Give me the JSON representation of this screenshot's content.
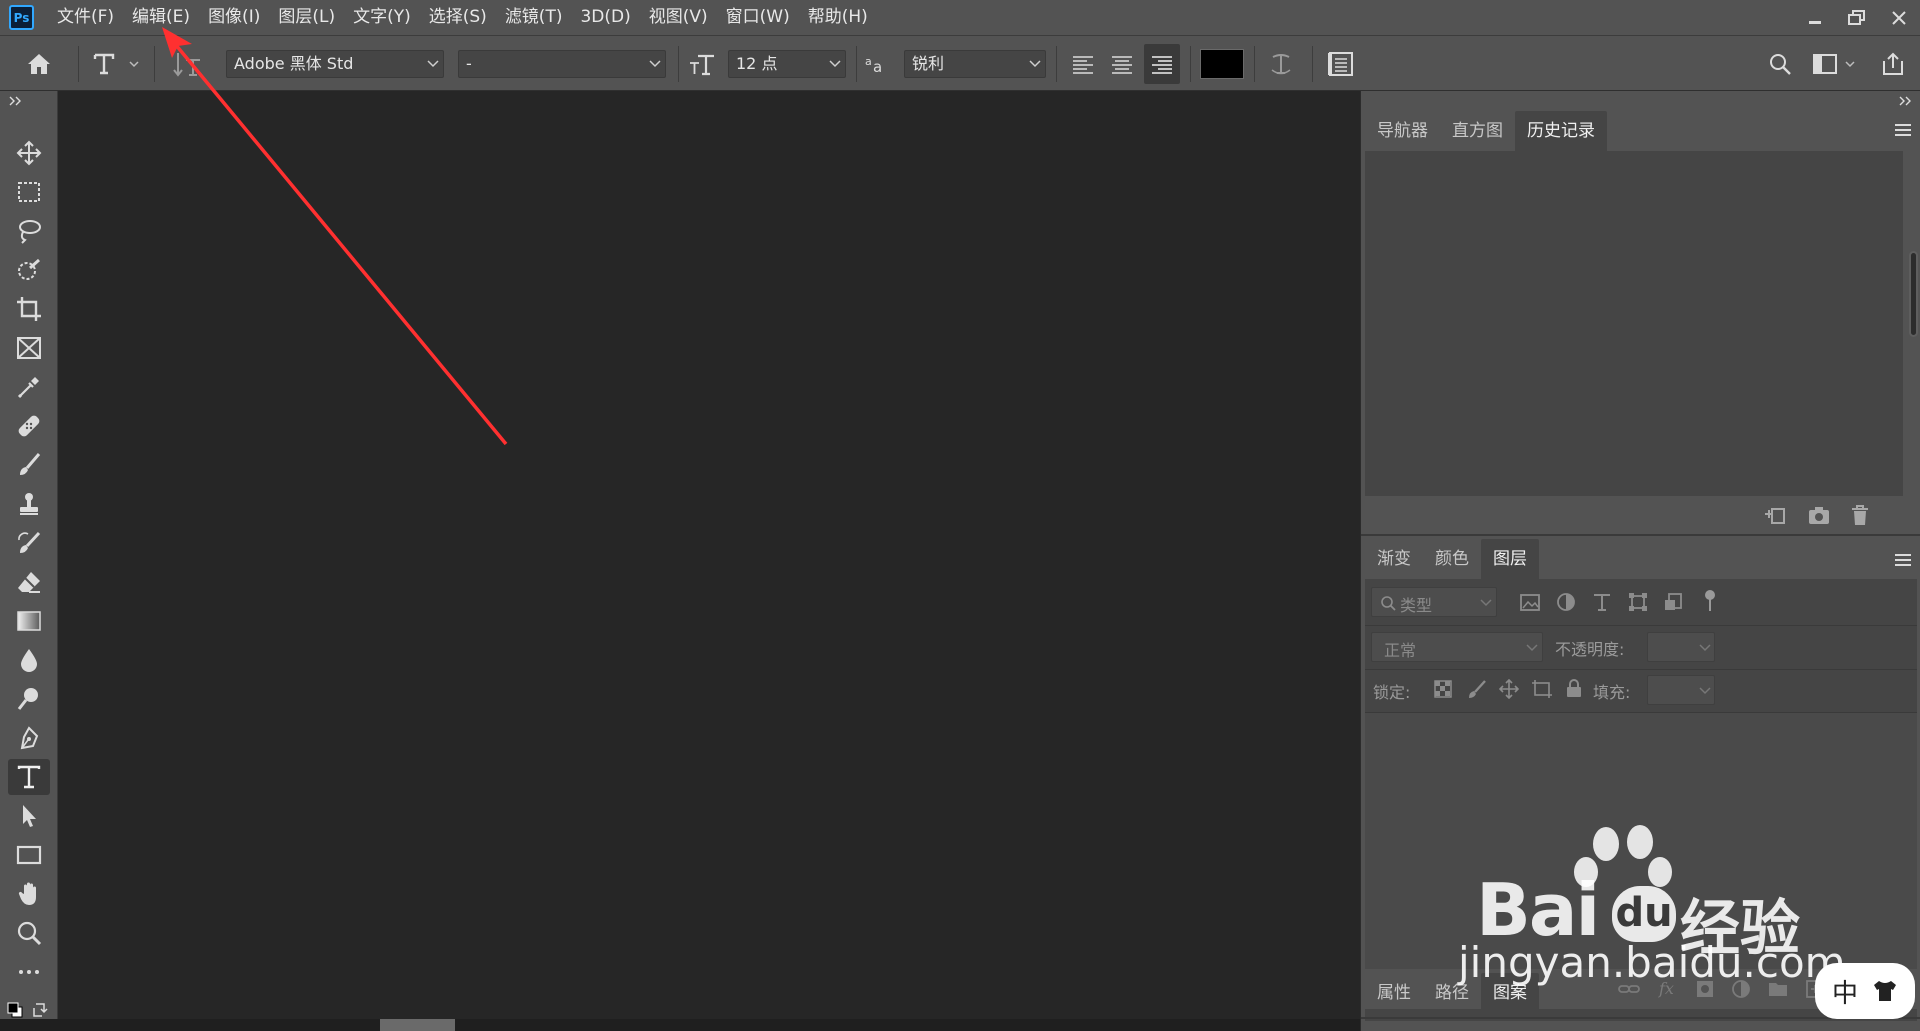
{
  "menubar": {
    "logo": "Ps",
    "items": [
      "文件(F)",
      "编辑(E)",
      "图像(I)",
      "图层(L)",
      "文字(Y)",
      "选择(S)",
      "滤镜(T)",
      "3D(D)",
      "视图(V)",
      "窗口(W)",
      "帮助(H)"
    ]
  },
  "options": {
    "font_family": "Adobe 黑体 Std",
    "font_style": "-",
    "font_size": "12 点",
    "antialias": "锐利",
    "text_color": "#000000"
  },
  "panels": {
    "top_tabs": [
      "导航器",
      "直方图",
      "历史记录"
    ],
    "mid_tabs": [
      "渐变",
      "颜色",
      "图层"
    ],
    "bottom_tabs": [
      "属性",
      "路径",
      "图案"
    ],
    "layers": {
      "filter_placeholder": "类型",
      "blend_mode": "正常",
      "opacity_label": "不透明度:",
      "lock_label": "锁定:",
      "fill_label": "填充:"
    }
  },
  "watermark": {
    "brand": "Bai",
    "brand_du": "du",
    "brand_cn": "经验",
    "url": "jingyan.baidu.com"
  },
  "ime": {
    "mode": "中"
  },
  "colors": {
    "annotation_arrow": "#ff3030",
    "ps_blue": "#31a8ff"
  }
}
